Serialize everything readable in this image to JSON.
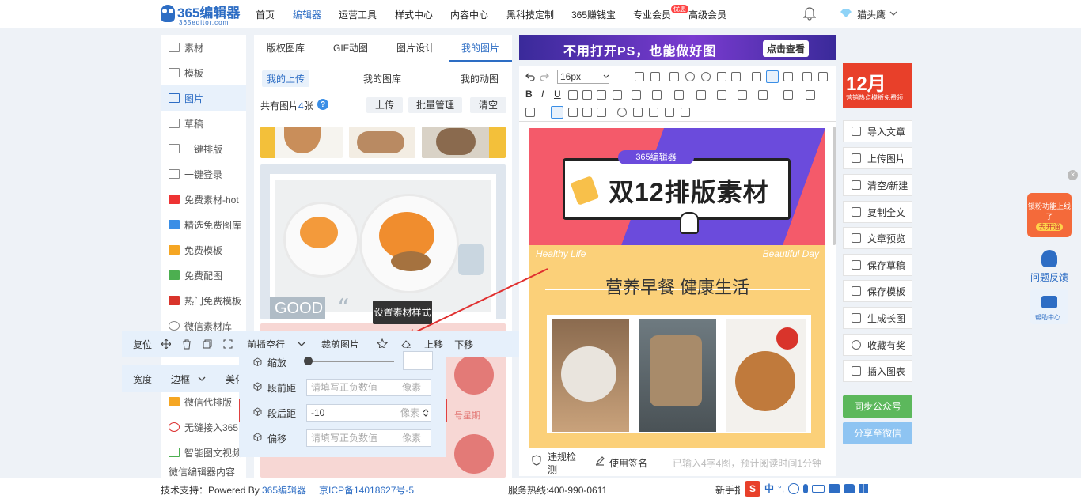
{
  "brand": {
    "logo_main": "365编辑器",
    "logo_sub": "365editor.com"
  },
  "nav": [
    "首页",
    "编辑器",
    "运营工具",
    "样式中心",
    "内容中心",
    "黑科技定制",
    "365赚钱宝",
    "专业会员",
    "高级会员"
  ],
  "nav_badge": "优惠",
  "user": {
    "name": "猫头鹰"
  },
  "sidebar": [
    "素材",
    "模板",
    "图片",
    "草稿",
    "一键排版",
    "一键登录",
    "免费素材-hot",
    "精选免费图库",
    "免费模板",
    "免费配图",
    "热门免费模板",
    "微信素材库",
    "微信代排版",
    "无缝接入365",
    "智能图文视频",
    "微信编辑器内容"
  ],
  "mid": {
    "tabs": [
      "版权图库",
      "GIF动图",
      "图片设计",
      "我的图片"
    ],
    "subtabs": [
      "我的上传",
      "我的图库",
      "我的动图"
    ],
    "count_prefix": "共有图片",
    "count": "4",
    "count_suffix": "张",
    "buttons": [
      "上传",
      "批量管理",
      "清空"
    ],
    "card_text": "GOOD",
    "card_side_text": "号星期"
  },
  "editor": {
    "banner_text": "不用打开PS，也能做好图",
    "banner_cta": "点击查看",
    "font_size": "16px",
    "poster_brand": "365编辑器",
    "poster_title": "双12排版素材",
    "tag_left": "Healthy Life",
    "tag_right": "Beautiful Day",
    "headline": "营养早餐 健康生活",
    "footer_check": "违规检测",
    "footer_sign": "使用签名",
    "footer_stats": "已输入4字4图，预计阅读时间1分钟"
  },
  "right": {
    "ad_title": "12月",
    "ad_sub": "营销热点模板免费领",
    "buttons": [
      "导入文章",
      "上传图片",
      "清空/新建",
      "复制全文",
      "文章预览",
      "保存草稿",
      "保存模板",
      "生成长图",
      "收藏有奖",
      "插入图表"
    ],
    "sync": "同步公众号",
    "share": "分享至微信",
    "float_ad": "锁粉功能上线了",
    "float_ad_btn": "去开通",
    "feedback": "问题反馈",
    "help": "帮助中心"
  },
  "float_toolbar": {
    "reset": "复位",
    "insert_blank": "前插空行",
    "crop": "裁剪图片",
    "up": "上移",
    "down": "下移",
    "width": "宽度",
    "border": "边框",
    "beauty": "美化",
    "tooltip": "设置素材样式"
  },
  "popup": {
    "rows": [
      {
        "label": "缩放",
        "value": ""
      },
      {
        "label": "段前距",
        "placeholder": "请填写正负数值",
        "unit": "像素"
      },
      {
        "label": "段后距",
        "value": "-10",
        "unit": "像素"
      },
      {
        "label": "偏移",
        "placeholder": "请填写正负数值",
        "unit": "像素"
      }
    ]
  },
  "footer": {
    "powered": "技术支持：Powered By",
    "powered_link": "365编辑器",
    "icp": "京ICP备14018627号-5",
    "hotline": "服务热线:400-990-0611",
    "guide": "新手指"
  },
  "ime": {
    "lang": "中"
  },
  "colors": {
    "brand": "#2d6dc4",
    "accent": "#e8402a",
    "green": "#5cb85c",
    "highlight": "#e04040"
  }
}
